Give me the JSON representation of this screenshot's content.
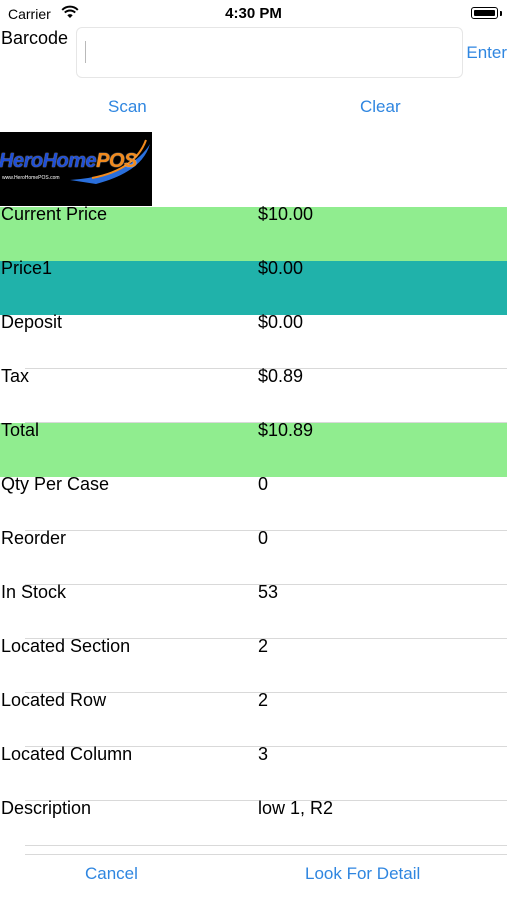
{
  "status_bar": {
    "carrier": "Carrier",
    "time": "4:30 PM"
  },
  "barcode": {
    "label": "Barcode",
    "value": "",
    "placeholder": "",
    "enter_label": "Enter"
  },
  "actions": {
    "scan_label": "Scan",
    "clear_label": "Clear"
  },
  "logo": {
    "name_part1": "HeroHome",
    "name_part2": "POS",
    "url": "www.HeroHomePOS.com"
  },
  "fields": [
    {
      "label": "Current Price",
      "value": "$10.00",
      "highlight": "green"
    },
    {
      "label": "Price1",
      "value": "$0.00",
      "highlight": "teal"
    },
    {
      "label": "Deposit",
      "value": "$0.00",
      "highlight": "none"
    },
    {
      "label": "Tax",
      "value": "$0.89",
      "highlight": "none"
    },
    {
      "label": "Total",
      "value": "$10.89",
      "highlight": "green"
    },
    {
      "label": "Qty Per Case",
      "value": "0",
      "highlight": "none"
    },
    {
      "label": "Reorder",
      "value": "0",
      "highlight": "none"
    },
    {
      "label": "In Stock",
      "value": "53",
      "highlight": "none"
    },
    {
      "label": "Located Section",
      "value": "2",
      "highlight": "none"
    },
    {
      "label": "Located Row",
      "value": "2",
      "highlight": "none"
    },
    {
      "label": "Located Column",
      "value": "3",
      "highlight": "none"
    },
    {
      "label": "Description",
      "value": "low 1, R2",
      "highlight": "none"
    }
  ],
  "footer": {
    "cancel_label": "Cancel",
    "detail_label": "Look For Detail"
  },
  "colors": {
    "accent": "#2f86e0",
    "highlight_green": "#90ed8f",
    "highlight_teal": "#20b2aa"
  }
}
